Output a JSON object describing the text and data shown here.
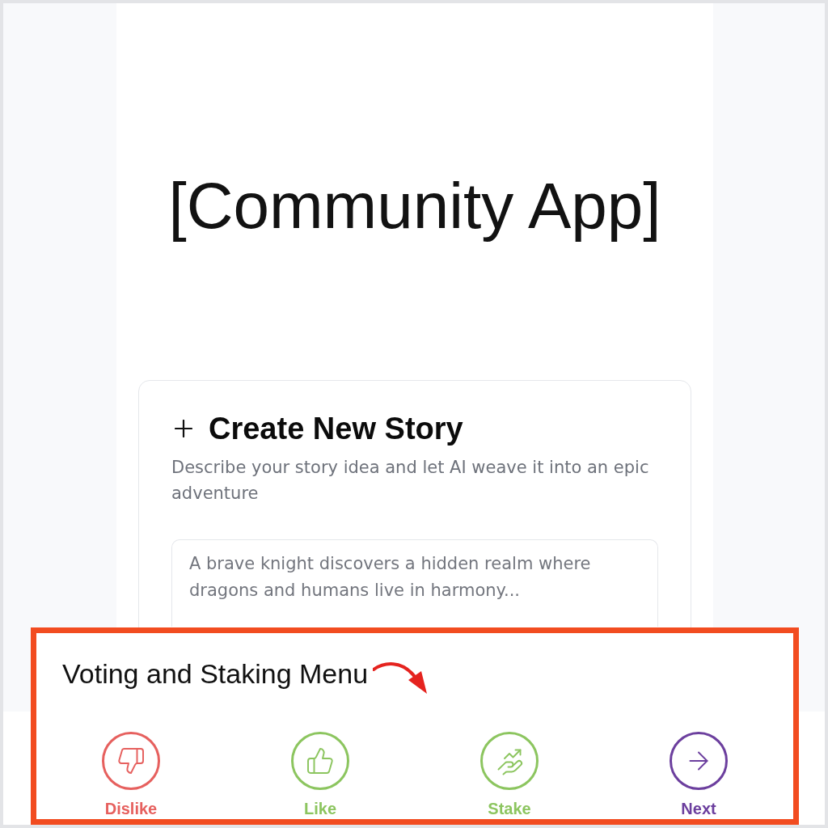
{
  "app_title": "[Community App]",
  "story_card": {
    "title": "Create New Story",
    "description": "Describe your story idea and let AI weave it into an epic adventure",
    "story_field": {
      "placeholder": "A brave knight discovers a hidden realm where dragons and humans live in harmony..."
    }
  },
  "menu_callout": {
    "label": "Voting and Staking Menu",
    "buttons": [
      {
        "kind": "dislike",
        "label": "Dislike",
        "color": "#e6605e"
      },
      {
        "kind": "like",
        "label": "Like",
        "color": "#8cc55f"
      },
      {
        "kind": "stake",
        "label": "Stake",
        "color": "#8cc55f"
      },
      {
        "kind": "next",
        "label": "Next",
        "color": "#6c3f9e"
      }
    ]
  }
}
